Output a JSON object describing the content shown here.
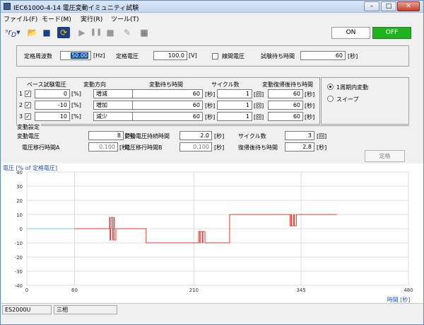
{
  "window": {
    "title": "IEC61000-4-14 電圧変動イミュニティ試験"
  },
  "menu": [
    "ファイル(F)",
    "モード(M)",
    "実行(R)",
    "ツール(T)"
  ],
  "toolbar": {
    "on_label": "ON",
    "off_label": "OFF"
  },
  "settings": {
    "rated_freq_label": "定格周波数",
    "rated_freq_value": "50.00",
    "rated_freq_unit": "[Hz]",
    "rated_voltage_label": "定格電圧",
    "rated_voltage_value": "100.0",
    "rated_voltage_unit": "[V]",
    "line_voltage_label": "線間電圧",
    "test_wait_label": "試験待ち時間",
    "test_wait_value": "60",
    "test_wait_unit": "[秒]"
  },
  "variation": {
    "headers": [
      "ベース試験電圧",
      "変動方向",
      "変動待ち時間",
      "サイクル数",
      "変動復帰後待ち時間"
    ],
    "rows": [
      {
        "index": "1",
        "base": "0",
        "base_unit": "[%]",
        "dir": "増減",
        "wait": "60",
        "wait_unit": "[秒]",
        "cycles": "1",
        "cycles_unit": "[回]",
        "rwait": "60",
        "rwait_unit": "[秒]"
      },
      {
        "index": "2",
        "base": "-10",
        "base_unit": "[%]",
        "dir": "増加",
        "wait": "60",
        "wait_unit": "[秒]",
        "cycles": "1",
        "cycles_unit": "[回]",
        "rwait": "60",
        "rwait_unit": "[秒]"
      },
      {
        "index": "3",
        "base": "10",
        "base_unit": "[%]",
        "dir": "減少",
        "wait": "60",
        "wait_unit": "[秒]",
        "cycles": "1",
        "cycles_unit": "[回]",
        "rwait": "60",
        "rwait_unit": "[秒]"
      }
    ]
  },
  "mode": {
    "option1": "1周期内変動",
    "option2": "スイープ"
  },
  "vsettings": {
    "group_label": "変動設定",
    "fluct_v_label": "変動電圧",
    "fluct_v_value": "8",
    "fluct_v_unit": "[%]",
    "hold_label": "変動電圧持続時間",
    "hold_value": "2.0",
    "hold_unit": "[秒]",
    "cycle_label": "サイクル数",
    "cycle_value": "3",
    "cycle_unit": "[回]",
    "trans_a_label": "電圧移行時間A",
    "trans_a_value": "0.100",
    "trans_a_unit": "[秒]",
    "trans_b_label": "電圧移行時間B",
    "trans_b_value": "0.100",
    "trans_b_unit": "[秒]",
    "recover_label": "復帰後待ち時間",
    "recover_value": "2.8",
    "recover_unit": "[秒]",
    "rated_button": "定格"
  },
  "chart_data": {
    "type": "line",
    "ylabel": "電圧 [% of 定格電圧]",
    "xlabel": "時間 [秒]",
    "y_ticks": [
      "40",
      "30",
      "20",
      "10",
      "0",
      "-10",
      "-20",
      "-30",
      "-40"
    ],
    "x_ticks": [
      "0",
      "60",
      "210",
      "345",
      "480"
    ],
    "ylim": [
      -40,
      40
    ],
    "xlim": [
      0,
      480
    ],
    "grid": true,
    "color": "#e53935",
    "pre_test_color": "#7fc7f0",
    "series": [
      {
        "x": [
          0,
          60,
          104,
          104,
          104.5,
          104.5,
          105.5,
          105.5,
          106,
          106,
          108,
          108,
          108.5,
          108.5,
          109.5,
          109.5,
          110,
          110,
          112,
          112,
          112.5,
          112.5,
          113.5,
          113.5,
          114,
          114,
          150,
          150,
          216,
          216,
          216.5,
          216.5,
          217.5,
          217.5,
          218,
          218,
          220,
          220,
          220.5,
          220.5,
          221.5,
          221.5,
          222,
          222,
          224,
          224,
          224.5,
          224.5,
          225.5,
          225.5,
          226,
          226,
          255,
          255,
          331,
          331,
          331.5,
          331.5,
          332.5,
          332.5,
          333,
          333,
          335,
          335,
          335.5,
          335.5,
          336.5,
          336.5,
          337,
          337,
          339,
          339,
          339.5,
          339.5,
          340.5,
          340.5,
          341,
          341,
          345,
          345,
          390,
          390
        ],
        "y": [
          0,
          0,
          0,
          8,
          8,
          -8,
          -8,
          0,
          0,
          8,
          8,
          -8,
          -8,
          0,
          0,
          8,
          8,
          -8,
          -8,
          0,
          0,
          0,
          0,
          0,
          0,
          0,
          0,
          -10,
          -10,
          -2,
          -2,
          -2,
          -2,
          -10,
          -10,
          -2,
          -2,
          -2,
          -2,
          -10,
          -10,
          -2,
          -2,
          -2,
          -2,
          -10,
          -10,
          -10,
          -10,
          -10,
          -10,
          -10,
          -10,
          10,
          10,
          2,
          2,
          2,
          2,
          10,
          10,
          2,
          2,
          2,
          2,
          10,
          10,
          2,
          2,
          2,
          2,
          10,
          10,
          10,
          10,
          10,
          10,
          10,
          10,
          10,
          10,
          10
        ]
      }
    ]
  },
  "status": {
    "model": "ES2000U",
    "phase": "三相"
  }
}
